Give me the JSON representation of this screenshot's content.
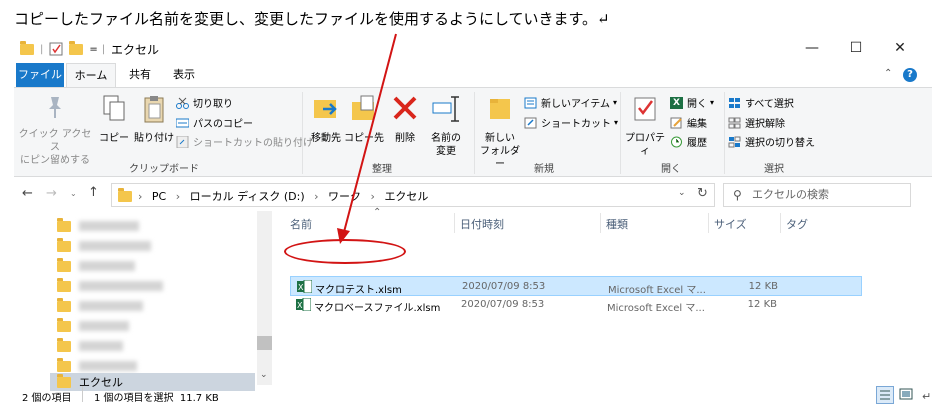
{
  "caption": "コピーしたファイル名前を変更し、変更したファイルを使用するようにしていきます。↵",
  "window": {
    "title": "エクセル",
    "qa_separator": "="
  },
  "tabs": [
    "ファイル",
    "ホーム",
    "共有",
    "表示"
  ],
  "ribbon": {
    "clipboard": {
      "label": "クリップボード",
      "pin_quick_access": "クイック アクセス\nにピン留めする",
      "copy": "コピー",
      "paste": "貼り付け",
      "cut": "切り取り",
      "copy_path": "パスのコピー",
      "paste_shortcut": "ショートカットの貼り付け"
    },
    "organize": {
      "label": "整理",
      "move_to": "移動先",
      "copy_to": "コピー先",
      "delete": "削除",
      "rename": "名前の\n変更"
    },
    "new": {
      "label": "新規",
      "new_folder": "新しい\nフォルダー",
      "new_item": "新しいアイテム",
      "shortcut": "ショートカット"
    },
    "open": {
      "label": "開く",
      "properties": "プロパティ",
      "open": "開く",
      "edit": "編集",
      "history": "履歴"
    },
    "select": {
      "label": "選択",
      "select_all": "すべて選択",
      "select_none": "選択解除",
      "invert": "選択の切り替え"
    }
  },
  "address": {
    "path": [
      "PC",
      "ローカル ディスク (D:)",
      "ワーク",
      "エクセル"
    ],
    "search_placeholder": "エクセルの検索"
  },
  "nav": {
    "selected": "エクセル"
  },
  "columns": [
    "名前",
    "日付時刻",
    "種類",
    "サイズ",
    "タグ"
  ],
  "files": [
    {
      "name": "マクロテスト.xlsm",
      "date": "2020/07/09 8:53",
      "type": "Microsoft Excel マ...",
      "size": "12 KB",
      "selected": true
    },
    {
      "name": "マクロベースファイル.xlsm",
      "date": "2020/07/09 8:53",
      "type": "Microsoft Excel マ...",
      "size": "12 KB",
      "selected": false
    }
  ],
  "status": {
    "count": "2 個の項目",
    "selection": "1 個の項目を選択  11.7 KB"
  },
  "colors": {
    "accent": "#1979ca",
    "selection": "#cce8ff",
    "annotation": "#d21414",
    "folder": "#f4c64c",
    "excel": "#1d7044"
  }
}
